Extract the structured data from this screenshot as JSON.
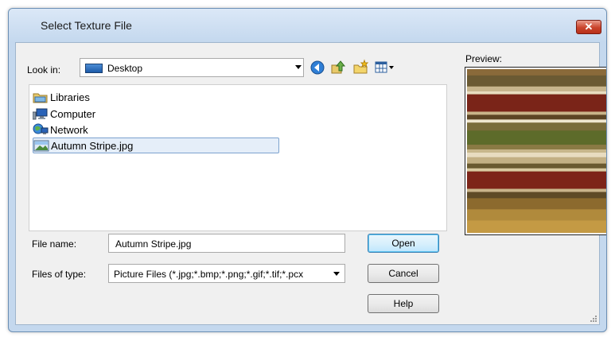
{
  "window": {
    "title": "Select Texture File",
    "close_label": "✕"
  },
  "lookin": {
    "label": "Look in:",
    "value": "Desktop"
  },
  "toolbar": {
    "icons": [
      "back-icon",
      "up-folder-icon",
      "new-folder-icon",
      "view-menu-icon"
    ]
  },
  "files": [
    {
      "name": "Libraries",
      "icon": "libraries-icon"
    },
    {
      "name": "Computer",
      "icon": "computer-icon"
    },
    {
      "name": "Network",
      "icon": "network-icon"
    },
    {
      "name": "Autumn Stripe.jpg",
      "icon": "image-file-icon",
      "selected": true
    }
  ],
  "preview": {
    "label": "Preview:"
  },
  "filename": {
    "label": "File name:",
    "value": "Autumn Stripe.jpg"
  },
  "filetype": {
    "label": "Files of type:",
    "value": "Picture Files (*.jpg;*.bmp;*.png;*.gif;*.tif;*.pcx"
  },
  "buttons": {
    "open": "Open",
    "cancel": "Cancel",
    "help": "Help"
  },
  "colors": {
    "accent": "#3c7fb1",
    "selection": "#e5eef9",
    "close": "#c9442c"
  }
}
